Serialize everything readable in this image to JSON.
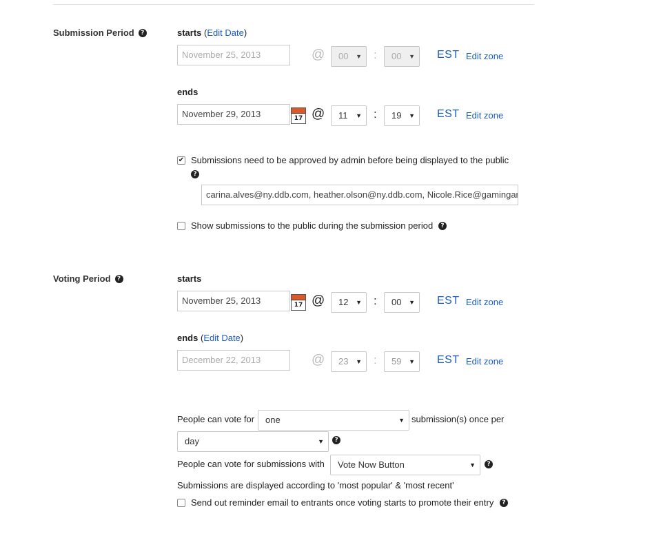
{
  "submission_period": {
    "label": "Submission Period",
    "starts": {
      "label": "starts",
      "edit_date": "Edit Date",
      "date": "November 25, 2013",
      "hour": "00",
      "minute": "00",
      "tz": "EST",
      "edit_zone": "Edit zone"
    },
    "ends": {
      "label": "ends",
      "date": "November 29, 2013",
      "cal_day": "17",
      "hour": "11",
      "minute": "19",
      "tz": "EST",
      "edit_zone": "Edit zone"
    },
    "approval": {
      "checked": true,
      "text": "Submissions need to be approved by admin before being displayed to the public",
      "emails": "carina.alves@ny.ddb.com, heather.olson@ny.ddb.com, Nicole.Rice@gamingandleisure.com"
    },
    "show_public": {
      "checked": false,
      "text": "Show submissions to the public during the submission period"
    }
  },
  "voting_period": {
    "label": "Voting Period",
    "starts": {
      "label": "starts",
      "date": "November 25, 2013",
      "cal_day": "17",
      "hour": "12",
      "minute": "00",
      "tz": "EST",
      "edit_zone": "Edit zone"
    },
    "ends": {
      "label": "ends",
      "edit_date": "Edit Date",
      "date": "December 22, 2013",
      "hour": "23",
      "minute": "59",
      "tz": "EST",
      "edit_zone": "Edit zone"
    },
    "vote_for_prefix": "People can vote for",
    "vote_count": "one",
    "vote_for_suffix": "submission(s) once per",
    "per_period": "day",
    "vote_with_prefix": "People can vote for submissions with",
    "vote_method": "Vote Now Button",
    "display_text": "Submissions are displayed according to 'most popular' & 'most recent'",
    "reminder": {
      "checked": false,
      "text": "Send out reminder email to entrants once voting starts to promote their entry"
    }
  },
  "icons": {
    "help": "question-circle-icon",
    "calendar": "calendar-icon",
    "dropdown": "chevron-down-icon",
    "help_glyph": "?",
    "arrow_glyph": "▼",
    "check_glyph": "✔",
    "at_glyph": "@",
    "colon_glyph": ":",
    "open_paren": "(",
    "close_paren": ")"
  },
  "colors": {
    "link": "#1a5bbf",
    "calendar": "#d8592b"
  }
}
